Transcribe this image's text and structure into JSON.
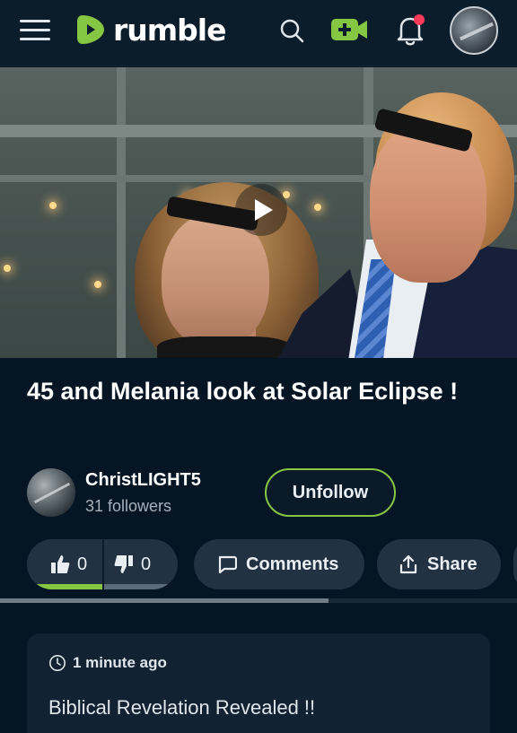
{
  "header": {
    "brand": "rumble",
    "icons": [
      "menu-icon",
      "search-icon",
      "upload-video-icon",
      "notification-bell-icon"
    ],
    "colors": {
      "brand_green": "#85c742",
      "notification_dot": "#ff3b5c",
      "background": "#0b1c2b"
    }
  },
  "video": {
    "title": "45 and Melania look at Solar Eclipse !",
    "play_icon": "play-icon"
  },
  "channel": {
    "name": "ChristLIGHT5",
    "followers": "31 followers",
    "follow_button": "Unfollow"
  },
  "actions": {
    "likes": "0",
    "dislikes": "0",
    "comments_label": "Comments",
    "share_label": "Share",
    "vote_ratio_up": 0.5
  },
  "description": {
    "time_ago": "1 minute ago",
    "text": "Biblical Revelation Revealed !!"
  }
}
